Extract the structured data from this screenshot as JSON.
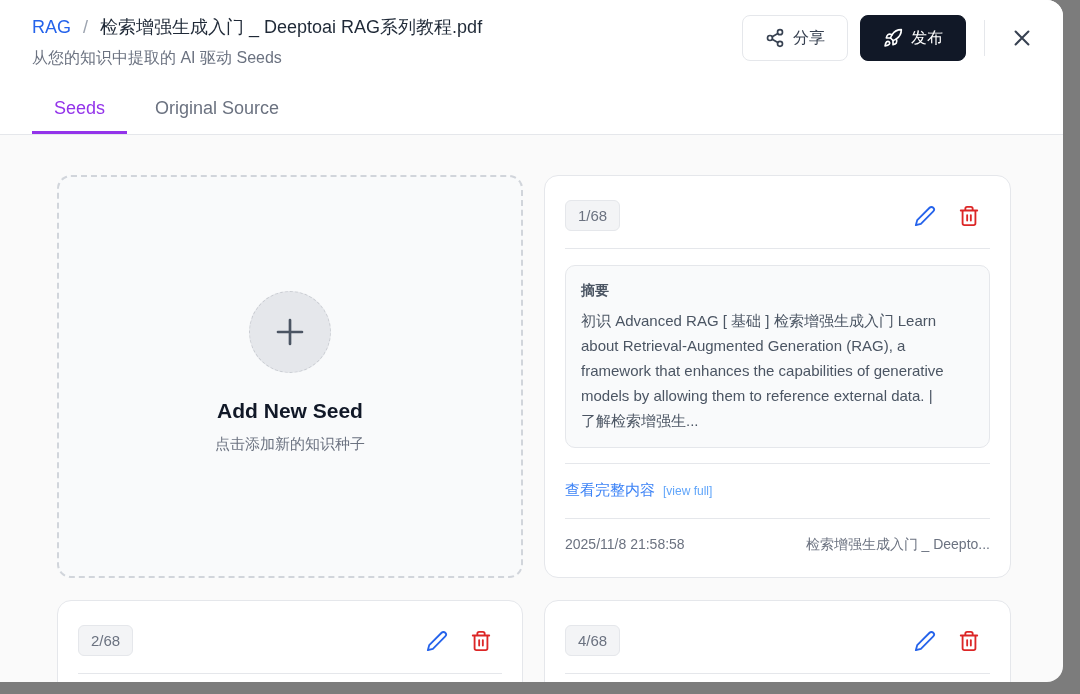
{
  "breadcrumb": {
    "root": "RAG",
    "separator": "/",
    "title": "检索增强生成入门 _ Deeptoai RAG系列教程.pdf"
  },
  "subtitle": "从您的知识中提取的 AI 驱动 Seeds",
  "actions": [
    {
      "kind": "share",
      "label": "分享"
    },
    {
      "kind": "publish",
      "label": "发布"
    }
  ],
  "tabs": [
    {
      "label": "Seeds",
      "selected": true
    },
    {
      "label": "Original Source",
      "selected": false
    }
  ],
  "cards": [
    {
      "kind": "add",
      "title": "Add New Seed",
      "hint": "点击添加新的知识种子"
    },
    {
      "kind": "seed",
      "index": "1/68",
      "summary_label": "摘要",
      "summary": "初识 Advanced RAG [ 基础 ] 检索增强生成入门 Learn about Retrieval-Augmented Generation (RAG), a framework that enhances the capabilities of generative models by allowing them to reference external data. | 了解检索增强生...",
      "link": "查看完整内容",
      "link_hint": "[view full]",
      "date": "2025/11/8 21:58:58",
      "source": "检索增强生成入门 _ Deepto..."
    },
    {
      "kind": "seed",
      "index": "2/68"
    },
    {
      "kind": "seed",
      "index": "4/68"
    }
  ]
}
